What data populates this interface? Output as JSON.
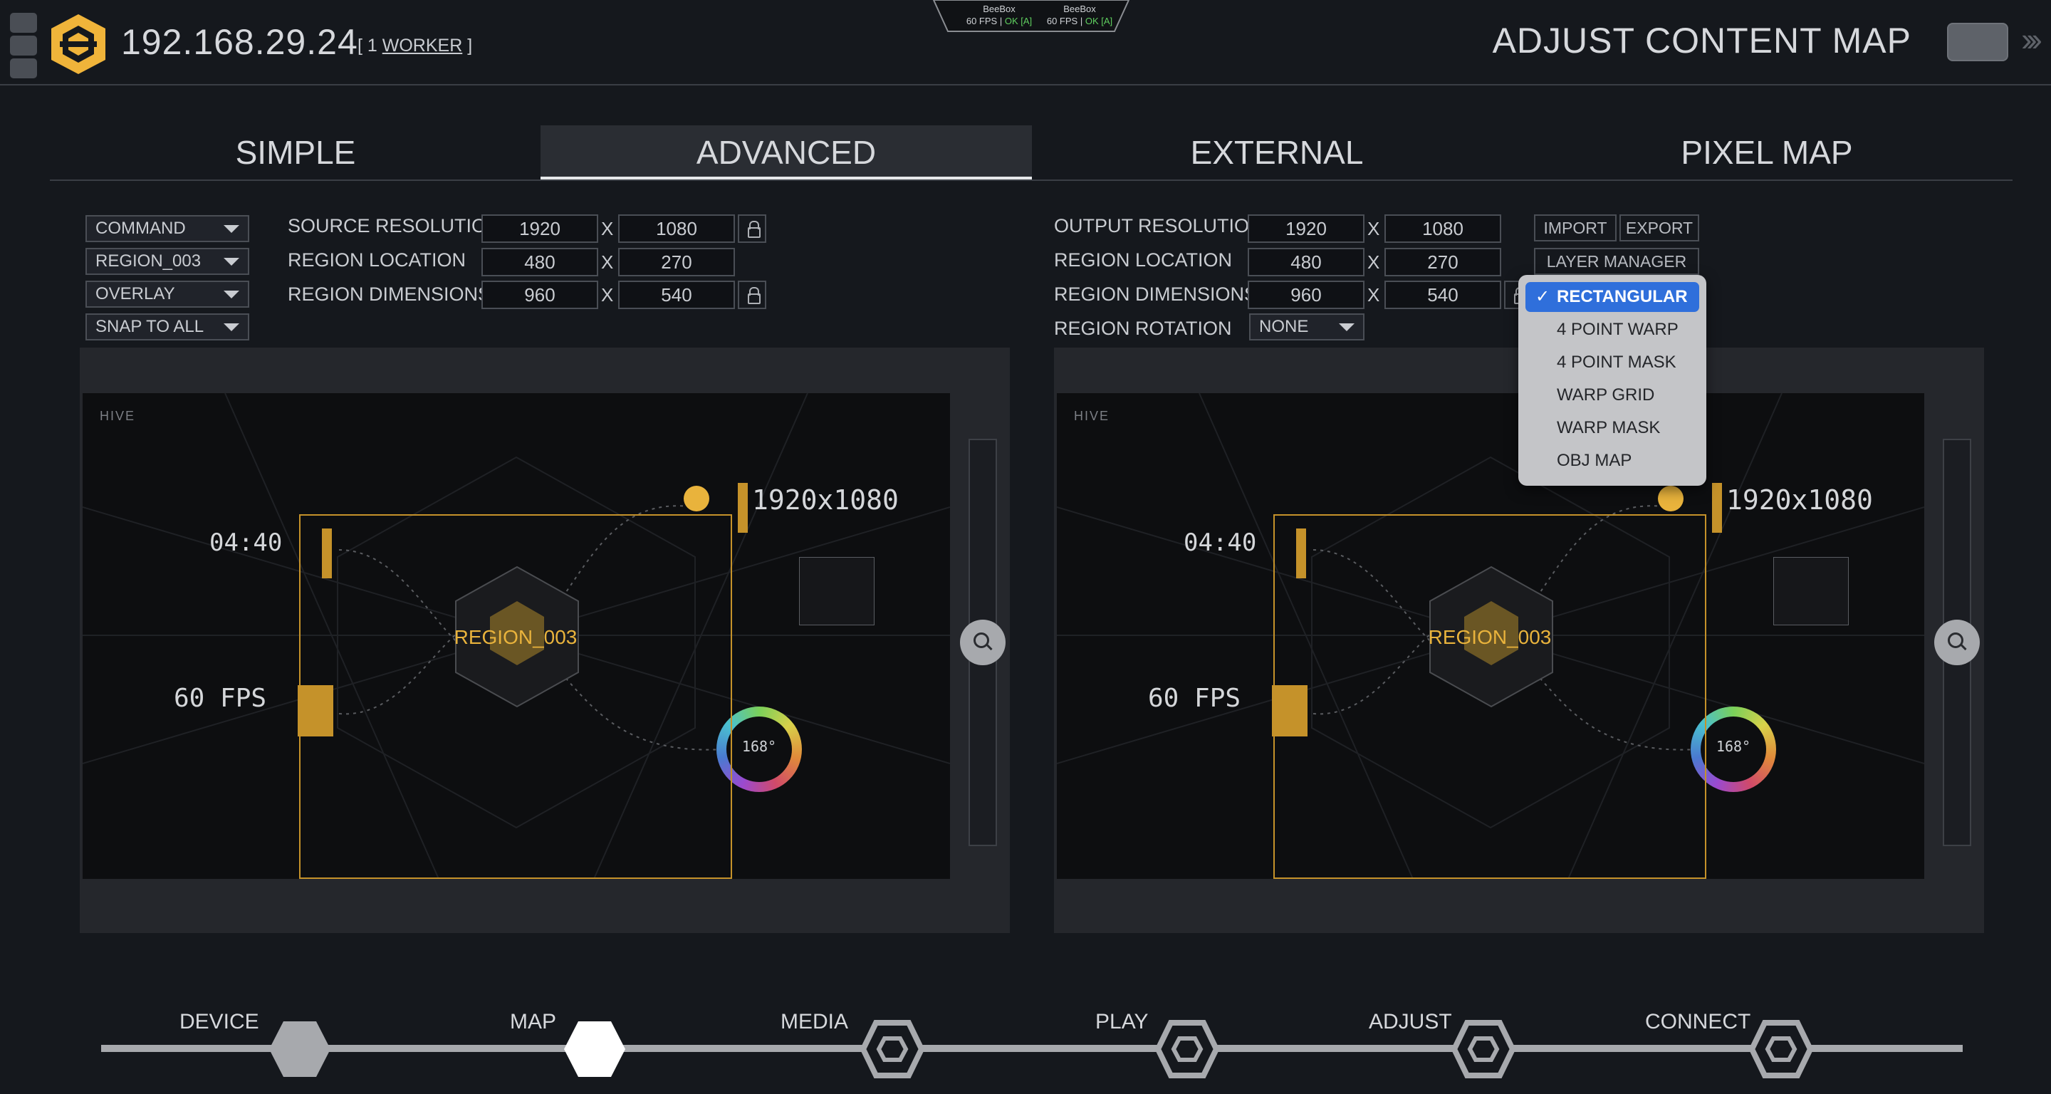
{
  "header": {
    "ip": "192.168.29.24",
    "workers_prefix": "[ 1 ",
    "workers_link": "WORKER",
    "workers_suffix": " ]",
    "mode_title": "ADJUST CONTENT MAP",
    "devices": [
      {
        "name": "BeeBox",
        "fps": "60 FPS",
        "sep": " | ",
        "status": "OK [A]"
      },
      {
        "name": "BeeBox",
        "fps": "60 FPS",
        "sep": " | ",
        "status": "OK [A]"
      }
    ]
  },
  "tabs": [
    "SIMPLE",
    "ADVANCED",
    "EXTERNAL",
    "PIXEL MAP"
  ],
  "active_tab": "ADVANCED",
  "left": {
    "dropdowns": [
      "COMMAND",
      "REGION_003",
      "OVERLAY",
      "SNAP TO ALL"
    ],
    "source_resolution": {
      "label": "SOURCE RESOLUTION",
      "w": "1920",
      "h": "1080"
    },
    "region_location": {
      "label": "REGION LOCATION",
      "x": "480",
      "y": "270"
    },
    "region_dimensions": {
      "label": "REGION DIMENSIONS",
      "w": "960",
      "h": "540"
    }
  },
  "right": {
    "output_resolution": {
      "label": "OUTPUT RESOLUTION",
      "w": "1920",
      "h": "1080"
    },
    "region_location": {
      "label": "REGION LOCATION",
      "x": "480",
      "y": "270"
    },
    "region_dimensions": {
      "label": "REGION DIMENSIONS",
      "w": "960",
      "h": "540"
    },
    "region_rotation": {
      "label": "REGION ROTATION",
      "value": "NONE"
    },
    "import": "IMPORT",
    "export": "EXPORT",
    "layer_manager": "LAYER MANAGER"
  },
  "x_sep": "X",
  "preview": {
    "logo": "HIVE",
    "time": "04:40",
    "resolution": "1920x1080",
    "fps": "60 FPS",
    "ring_value": "168°",
    "region_label": "REGION_003"
  },
  "shape_menu": {
    "items": [
      "RECTANGULAR",
      "4 POINT WARP",
      "4 POINT MASK",
      "WARP GRID",
      "WARP MASK",
      "OBJ MAP"
    ],
    "selected": "RECTANGULAR",
    "check": "✓"
  },
  "nav": [
    "DEVICE",
    "MAP",
    "MEDIA",
    "PLAY",
    "ADJUST",
    "CONNECT"
  ],
  "nav_active": "MAP",
  "colors": {
    "accent": "#e9b33c",
    "selection": "#2f6fdb",
    "ok": "#5fcf5f"
  }
}
